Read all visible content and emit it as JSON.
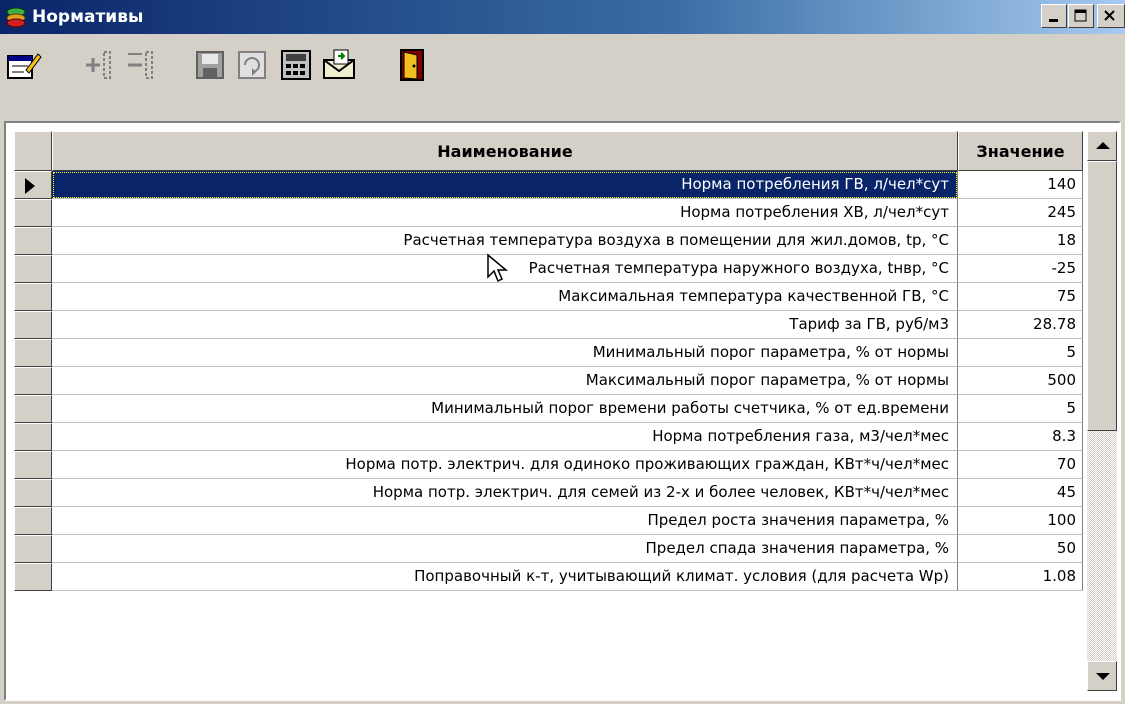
{
  "window": {
    "title": "Нормативы",
    "titlebar_colors": [
      "#0a246a",
      "#a6caf0"
    ]
  },
  "toolbar": {
    "buttons": [
      {
        "name": "edit",
        "icon": "edit-form-icon",
        "enabled": true
      },
      {
        "name": "add-column",
        "icon": "insert-column-icon",
        "enabled": false
      },
      {
        "name": "remove-column",
        "icon": "delete-column-icon",
        "enabled": false
      },
      {
        "name": "save",
        "icon": "floppy-disk-icon",
        "enabled": false
      },
      {
        "name": "refresh",
        "icon": "refresh-icon",
        "enabled": false
      },
      {
        "name": "print",
        "icon": "calculator-report-icon",
        "enabled": true
      },
      {
        "name": "export",
        "icon": "envelope-export-icon",
        "enabled": true
      },
      {
        "name": "exit",
        "icon": "exit-door-icon",
        "enabled": true
      }
    ]
  },
  "grid": {
    "columns": {
      "name": "Наименование",
      "value": "Значение"
    },
    "selected_index": 0,
    "selection_color": "#0a246a",
    "rows": [
      {
        "name": "Норма потребления ГВ, л/чел*сут",
        "value": "140"
      },
      {
        "name": "Норма потребления ХВ, л/чел*сут",
        "value": "245"
      },
      {
        "name": "Расчетная температура воздуха в помещении для жил.домов, tр, °С",
        "value": "18"
      },
      {
        "name": "Расчетная температура наружного воздуха, tнвр, °С",
        "value": "-25"
      },
      {
        "name": "Максимальная температура качественной ГВ, °С",
        "value": "75"
      },
      {
        "name": "Тариф за ГВ, руб/м3",
        "value": "28.78"
      },
      {
        "name": "Минимальный порог параметра, % от нормы",
        "value": "5"
      },
      {
        "name": "Максимальный порог параметра, % от нормы",
        "value": "500"
      },
      {
        "name": "Минимальный порог времени работы счетчика, % от ед.времени",
        "value": "5"
      },
      {
        "name": "Норма потребления газа, м3/чел*мес",
        "value": "8.3"
      },
      {
        "name": "Норма потр. электрич. для одиноко проживающих граждан, КВт*ч/чел*мес",
        "value": "70"
      },
      {
        "name": "Норма потр. электрич. для семей из 2-х и более человек, КВт*ч/чел*мес",
        "value": "45"
      },
      {
        "name": "Предел роста значения параметра, %",
        "value": "100"
      },
      {
        "name": "Предел спада значения параметра, %",
        "value": "50"
      },
      {
        "name": "Поправочный к-т, учитывающий климат. условия (для расчета  Wp)",
        "value": "1.08"
      }
    ]
  }
}
